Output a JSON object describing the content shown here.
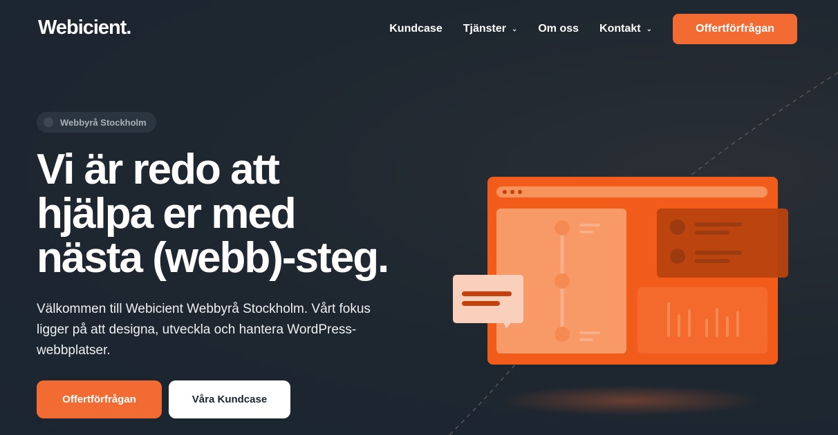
{
  "header": {
    "logo": "Webicient.",
    "nav": [
      {
        "label": "Kundcase",
        "has_dropdown": false
      },
      {
        "label": "Tjänster",
        "has_dropdown": true
      },
      {
        "label": "Om oss",
        "has_dropdown": false
      },
      {
        "label": "Kontakt",
        "has_dropdown": true
      }
    ],
    "cta_label": "Offertförfrågan"
  },
  "hero": {
    "badge": "Webbyrå Stockholm",
    "headline_lines": [
      "Vi är redo att",
      "hjälpa er med",
      "nästa (webb)-steg."
    ],
    "lead": "Välkommen till Webicient Webbyrå Stockholm. Vårt fokus ligger på att designa, utveckla och hantera WordPress-webbplatser.",
    "primary_button": "Offertförfrågan",
    "secondary_button": "Våra Kundcase"
  },
  "colors": {
    "background": "#1b2530",
    "accent": "#f26b33",
    "white": "#ffffff"
  },
  "icons": {
    "dropdown": "chevron-down-icon",
    "badge": "dot-icon"
  }
}
